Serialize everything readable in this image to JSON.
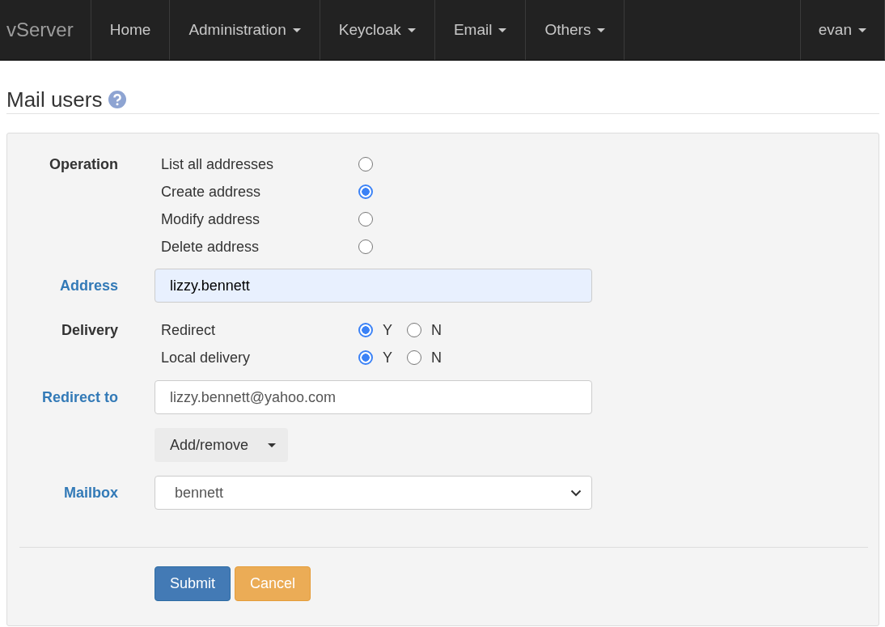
{
  "navbar": {
    "brand": "vServer",
    "items": [
      {
        "label": "Home",
        "dropdown": false
      },
      {
        "label": "Administration",
        "dropdown": true
      },
      {
        "label": "Keycloak",
        "dropdown": true
      },
      {
        "label": "Email",
        "dropdown": true
      },
      {
        "label": "Others",
        "dropdown": true
      }
    ],
    "user": {
      "label": "evan",
      "dropdown": true
    }
  },
  "page": {
    "title": "Mail users"
  },
  "form": {
    "rows": [
      {
        "kind": "radio-group",
        "label": "Operation",
        "options": [
          {
            "label": "List all addresses",
            "selected": false
          },
          {
            "label": "Create address",
            "selected": true
          },
          {
            "label": "Modify address",
            "selected": false
          },
          {
            "label": "Delete address",
            "selected": false
          }
        ]
      },
      {
        "kind": "text",
        "label": "Address",
        "value": "lizzy.bennett",
        "autofilled": true
      },
      {
        "kind": "choice-group",
        "label": "Delivery",
        "options": [
          {
            "label": "Redirect",
            "choices": [
              {
                "label": "Y",
                "selected": true
              },
              {
                "label": "N",
                "selected": false
              }
            ]
          },
          {
            "label": "Local delivery",
            "choices": [
              {
                "label": "Y",
                "selected": true
              },
              {
                "label": "N",
                "selected": false
              }
            ]
          }
        ]
      },
      {
        "kind": "text",
        "label": "Redirect to",
        "value": "lizzy.bennett@yahoo.com",
        "autofilled": false
      },
      {
        "kind": "dropdown-button",
        "label_text": "Add/remove"
      },
      {
        "kind": "select",
        "label": "Mailbox",
        "value": "bennett"
      }
    ],
    "buttons": [
      {
        "label": "Submit",
        "kind": "primary"
      },
      {
        "label": "Cancel",
        "kind": "warning"
      }
    ]
  }
}
